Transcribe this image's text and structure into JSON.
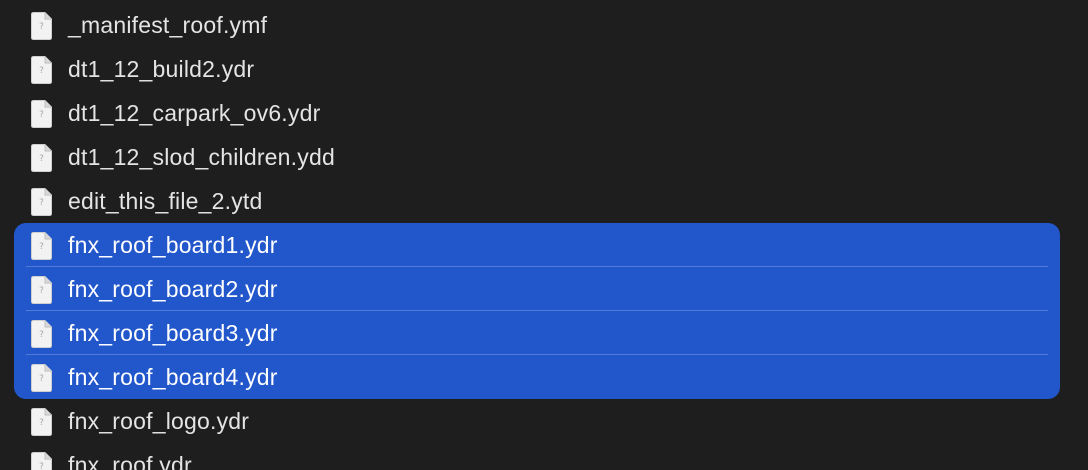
{
  "files": [
    {
      "name": "_manifest_roof.ymf",
      "icon": "document-icon",
      "selected": false
    },
    {
      "name": "dt1_12_build2.ydr",
      "icon": "document-icon",
      "selected": false
    },
    {
      "name": "dt1_12_carpark_ov6.ydr",
      "icon": "document-icon",
      "selected": false
    },
    {
      "name": "dt1_12_slod_children.ydd",
      "icon": "document-icon",
      "selected": false
    },
    {
      "name": "edit_this_file_2.ytd",
      "icon": "document-icon",
      "selected": false
    },
    {
      "name": "fnx_roof_board1.ydr",
      "icon": "document-icon",
      "selected": true
    },
    {
      "name": "fnx_roof_board2.ydr",
      "icon": "document-icon",
      "selected": true
    },
    {
      "name": "fnx_roof_board3.ydr",
      "icon": "document-icon",
      "selected": true
    },
    {
      "name": "fnx_roof_board4.ydr",
      "icon": "document-icon",
      "selected": true
    },
    {
      "name": "fnx_roof_logo.ydr",
      "icon": "document-icon",
      "selected": false
    },
    {
      "name": "fnx_roof.ydr",
      "icon": "document-icon",
      "selected": false
    }
  ],
  "colors": {
    "background": "#1e1e1e",
    "selection": "#2257cc",
    "text": "#e4e4e4"
  }
}
